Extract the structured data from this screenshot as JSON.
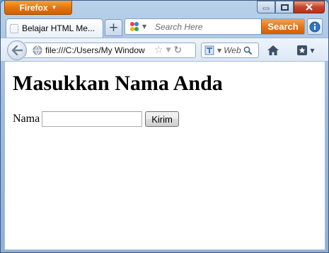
{
  "browser": {
    "menu_button_label": "Firefox",
    "tab_title": "Belajar HTML Me...",
    "new_tab_symbol": "+",
    "search_placeholder": "Search Here",
    "search_button_label": "Search",
    "address": "file:///C:/Users/My Window",
    "web_search_label": "Web"
  },
  "page": {
    "heading": "Masukkan Nama Anda",
    "name_label": "Nama",
    "name_value": "",
    "submit_label": "Kirim"
  },
  "colors": {
    "firefox_orange": "#e2730e",
    "chrome_blue": "#9dbcdf",
    "close_red": "#c7432b"
  },
  "icons": [
    "firefox-menu-caret-icon",
    "minimize-icon",
    "maximize-icon",
    "close-icon",
    "page-icon",
    "new-tab-icon",
    "search-engine-icon",
    "info-icon",
    "back-arrow-icon",
    "globe-icon",
    "bookmark-star-icon",
    "reload-icon",
    "web-search-icon",
    "magnifier-icon",
    "home-icon",
    "bookmarks-menu-icon"
  ]
}
